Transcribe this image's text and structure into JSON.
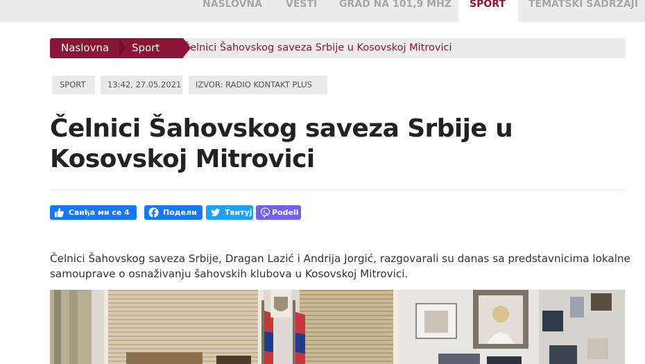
{
  "nav": {
    "items": [
      {
        "label": "NASLOVNA"
      },
      {
        "label": "VESTI"
      },
      {
        "label": "GRAD NA 101,9 MHZ"
      },
      {
        "label": "SPORT"
      },
      {
        "label": "TEMATSKI SADRŽAJI"
      }
    ],
    "active_index": 3
  },
  "breadcrumb": {
    "home": "Naslovna",
    "section": "Sport",
    "current": "Čelnici Šahovskog saveza Srbije u Kosovskoj Mitrovici"
  },
  "meta": {
    "category": "SPORT",
    "datetime": "13:42, 27.05.2021",
    "source": "IZVOR: RADIO KONTAKT PLUS"
  },
  "article": {
    "title": "Čelnici Šahovskog saveza Srbije u Kosovskoj Mitrovici",
    "lead": "Čelnici Šahovskog saveza Srbije, Dragan Lazić i Andrija Jorgić, razgovarali su danas sa predstavnicima lokalne samouprave o osnaživanju šahovskih klubova u Kosovskoj Mitrovici."
  },
  "social": {
    "like": "Свиђа ми се 4",
    "share": "Подели",
    "tweet": "Твитуј",
    "viber": "Podeli"
  },
  "colors": {
    "brand": "#8a1538",
    "facebook": "#1877f2",
    "twitter": "#1da1f2",
    "viber": "#7360f2"
  }
}
